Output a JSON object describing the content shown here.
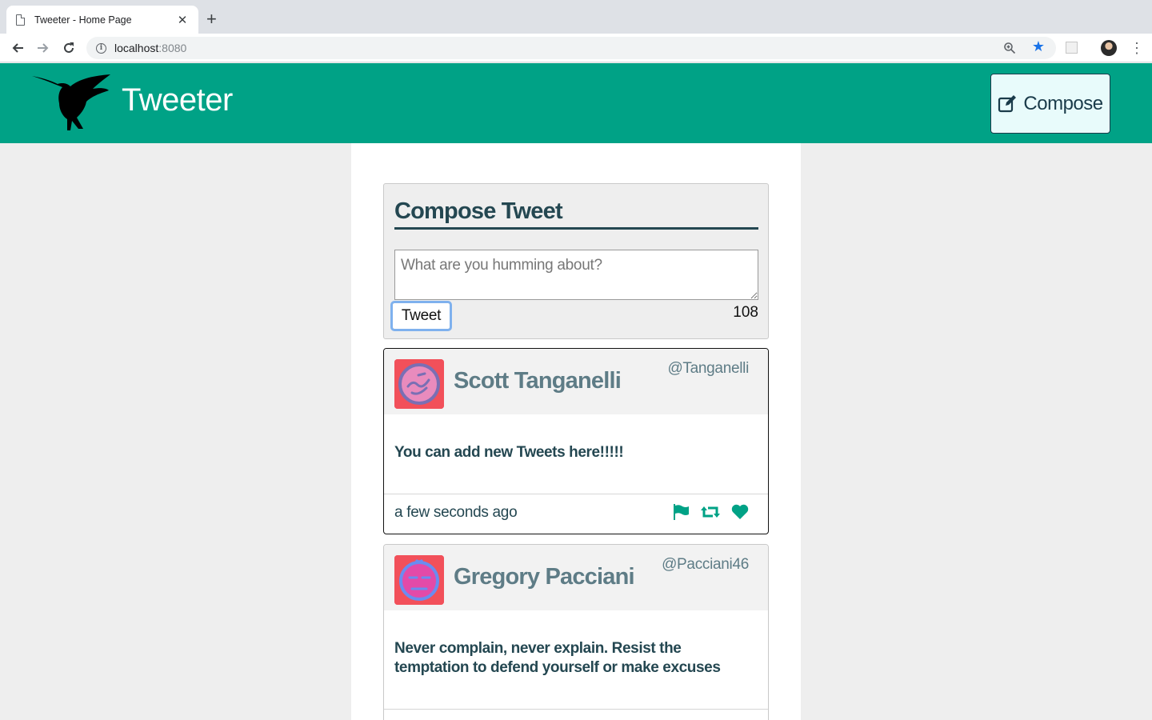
{
  "browser": {
    "tab_title": "Tweeter - Home Page",
    "tab_close": "✕",
    "new_tab": "+",
    "url_host": "localhost",
    "url_port": ":8080",
    "icons": [
      "back-icon",
      "forward-icon",
      "reload-icon",
      "info-icon",
      "zoom-icon",
      "star-icon",
      "extension-icon",
      "profile-avatar",
      "menu-icon"
    ]
  },
  "header": {
    "title": "Tweeter",
    "compose_label": "Compose",
    "brand_color": "#00a286"
  },
  "compose": {
    "heading": "Compose Tweet",
    "placeholder": "What are you humming about?",
    "submit_label": "Tweet",
    "counter": "108"
  },
  "tweets": [
    {
      "name": "Scott Tanganelli",
      "handle": "@Tanganelli",
      "content": "You can add new Tweets here!!!!!",
      "time": "a few seconds ago"
    },
    {
      "name": "Gregory Pacciani",
      "handle": "@Pacciani46",
      "content": "Never complain, never explain. Resist the temptation to defend yourself or make excuses"
    }
  ],
  "colors": {
    "accent": "#00a286",
    "heading_text": "#244751",
    "name_text": "#5e7c86",
    "avatar_bg": "#f2505a"
  }
}
